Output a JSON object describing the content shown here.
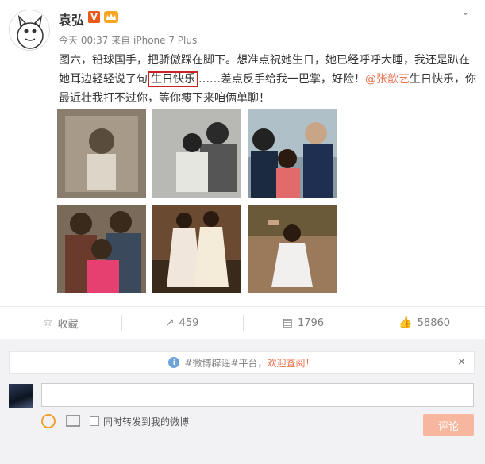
{
  "user": {
    "name": "袁弘",
    "v_badge": "V"
  },
  "post": {
    "meta": "今天 00:37 来自 iPhone 7 Plus",
    "text_line1": "图六，铅球国手，把骄傲踩在脚下。想准点祝她生日，她已经呼呼大睡，我还是",
    "text_before": "趴在她耳边轻轻说了句",
    "highlight": "生日快乐",
    "text_middle": "……差点反手给我一巴掌，好险！",
    "mention": "@张歆艺",
    "text_after": "生日快乐，你最近壮我打不过你，等你瘦下来咱俩单聊！"
  },
  "actions": [
    {
      "icon": "star-icon",
      "label": "收藏"
    },
    {
      "icon": "share-icon",
      "label": "459"
    },
    {
      "icon": "comment-icon",
      "label": "1796"
    },
    {
      "icon": "like-icon",
      "label": "58860"
    }
  ],
  "notice": {
    "info_glyph": "i",
    "text": "#微博辟谣#平台，",
    "link": "欢迎查阅！",
    "close": "×"
  },
  "composer": {
    "forward_label": "同时转发到我的微博",
    "submit_label": "评论"
  },
  "colors": {
    "accent": "#eb7350",
    "submit_bg": "#f7b79f",
    "highlight_box": "#cc2222"
  }
}
